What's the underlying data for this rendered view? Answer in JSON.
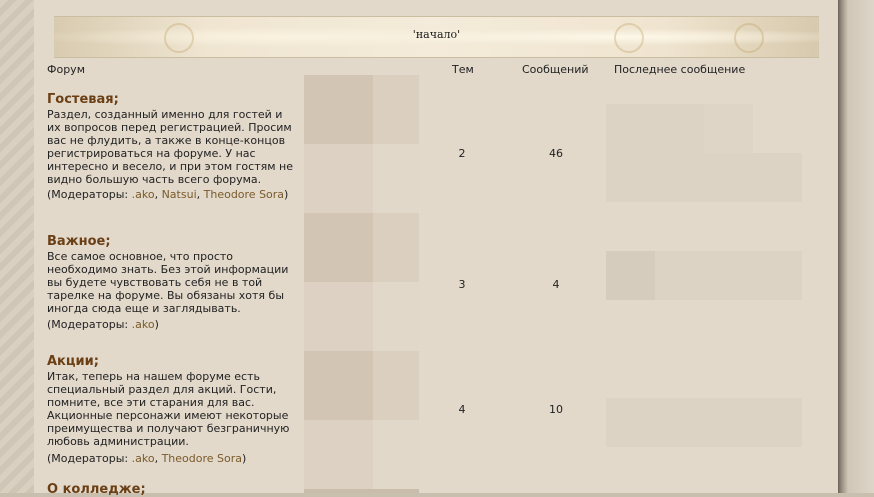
{
  "banner": {
    "title": "'начало'"
  },
  "header": {
    "forum": "Форум",
    "topics": "Тем",
    "posts": "Сообщений",
    "last_post": "Последнее сообщение"
  },
  "forums": [
    {
      "title": "Гостевая;",
      "description": "Раздел, созданный именно для гостей и их вопросов перед регистрацией. Просим вас не флудить, а также в конце-концов регистрироваться на форуме. У нас интересно и весело, и при этом гостям не видно большую часть всего форума.",
      "mods_prefix": "(Модераторы: ",
      "moderators": [
        ".ako",
        "Natsui",
        "Theodore Sora"
      ],
      "mods_suffix": ")",
      "topics": "2",
      "posts": "46"
    },
    {
      "title": "Важное;",
      "description": "Все самое основное, что просто необходимо знать. Без этой информации вы будете чувствовать себя не в той тарелке на форуме. Вы обязаны хотя бы иногда сюда еще и заглядывать.",
      "mods_prefix": "(Модераторы: ",
      "moderators": [
        ".ako"
      ],
      "mods_suffix": ")",
      "topics": "3",
      "posts": "4"
    },
    {
      "title": "Акции;",
      "description": "Итак, теперь на нашем форуме есть специальный раздел для акций. Гости, помните, все эти старания для вас. Акционные персонажи имеют некоторые преимущества и получают безграничную любовь администрации.",
      "mods_prefix": "(Модераторы: ",
      "moderators": [
        ".ako",
        "Theodore Sora"
      ],
      "mods_suffix": ")",
      "topics": "4",
      "posts": "10"
    },
    {
      "title": "О колледже;"
    }
  ],
  "colors": {
    "panel": "#e2d9cb",
    "forum_title": "#6b3f16",
    "moderator_link": "#7a5a2a"
  }
}
